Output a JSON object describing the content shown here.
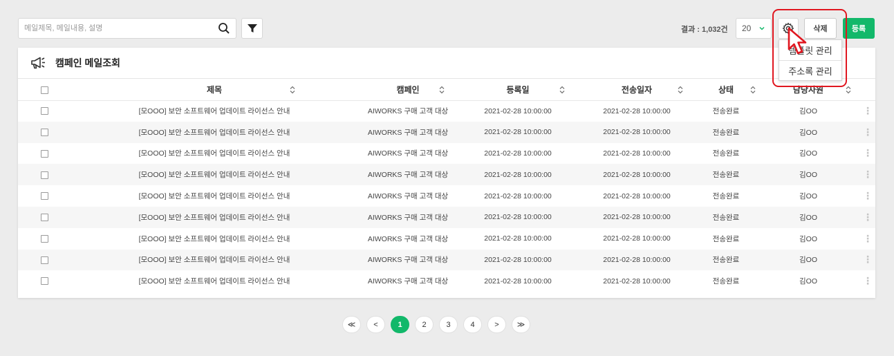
{
  "search": {
    "placeholder": "메일제목, 메일내용, 설명",
    "value": ""
  },
  "toolbar": {
    "result_label": "결과 : 1,032건",
    "page_size": "20",
    "delete_label": "삭제",
    "register_label": "등록"
  },
  "settings_menu": {
    "items": [
      "템플릿 관리",
      "주소록 관리"
    ]
  },
  "card": {
    "title": "캠페인 메일조회"
  },
  "table": {
    "columns": [
      "제목",
      "캠페인",
      "등록일",
      "전송일자",
      "상태",
      "담당사원"
    ],
    "rows": [
      [
        "[모OOO] 보안 소프트웨어 업데이트 라이선스 안내",
        "AIWORKS 구매 고객 대상",
        "2021-02-28 10:00:00",
        "2021-02-28 10:00:00",
        "전송완료",
        "김OO"
      ],
      [
        "[모OOO] 보안 소프트웨어 업데이트 라이선스 안내",
        "AIWORKS 구매 고객 대상",
        "2021-02-28 10:00:00",
        "2021-02-28 10:00:00",
        "전송완료",
        "김OO"
      ],
      [
        "[모OOO] 보안 소프트웨어 업데이트 라이선스 안내",
        "AIWORKS 구매 고객 대상",
        "2021-02-28 10:00:00",
        "2021-02-28 10:00:00",
        "전송완료",
        "김OO"
      ],
      [
        "[모OOO] 보안 소프트웨어 업데이트 라이선스 안내",
        "AIWORKS 구매 고객 대상",
        "2021-02-28 10:00:00",
        "2021-02-28 10:00:00",
        "전송완료",
        "김OO"
      ],
      [
        "[모OOO] 보안 소프트웨어 업데이트 라이선스 안내",
        "AIWORKS 구매 고객 대상",
        "2021-02-28 10:00:00",
        "2021-02-28 10:00:00",
        "전송완료",
        "김OO"
      ],
      [
        "[모OOO] 보안 소프트웨어 업데이트 라이선스 안내",
        "AIWORKS 구매 고객 대상",
        "2021-02-28 10:00:00",
        "2021-02-28 10:00:00",
        "전송완료",
        "김OO"
      ],
      [
        "[모OOO] 보안 소프트웨어 업데이트 라이선스 안내",
        "AIWORKS 구매 고객 대상",
        "2021-02-28 10:00:00",
        "2021-02-28 10:00:00",
        "전송완료",
        "김OO"
      ],
      [
        "[모OOO] 보안 소프트웨어 업데이트 라이선스 안내",
        "AIWORKS 구매 고객 대상",
        "2021-02-28 10:00:00",
        "2021-02-28 10:00:00",
        "전송완료",
        "김OO"
      ],
      [
        "[모OOO] 보안 소프트웨어 업데이트 라이선스 안내",
        "AIWORKS 구매 고객 대상",
        "2021-02-28 10:00:00",
        "2021-02-28 10:00:00",
        "전송완료",
        "김OO"
      ]
    ]
  },
  "pagination": {
    "first": "≪",
    "prev": "<",
    "next": ">",
    "last": "≫",
    "pages": [
      "1",
      "2",
      "3",
      "4"
    ],
    "current": "1"
  },
  "colors": {
    "accent": "#12b86a",
    "highlight": "#e0161f"
  },
  "icons": [
    "search-icon",
    "filter-icon",
    "chevron-down-icon",
    "gear-icon",
    "megaphone-icon",
    "sort-icon",
    "kebab-icon",
    "cursor-icon"
  ]
}
